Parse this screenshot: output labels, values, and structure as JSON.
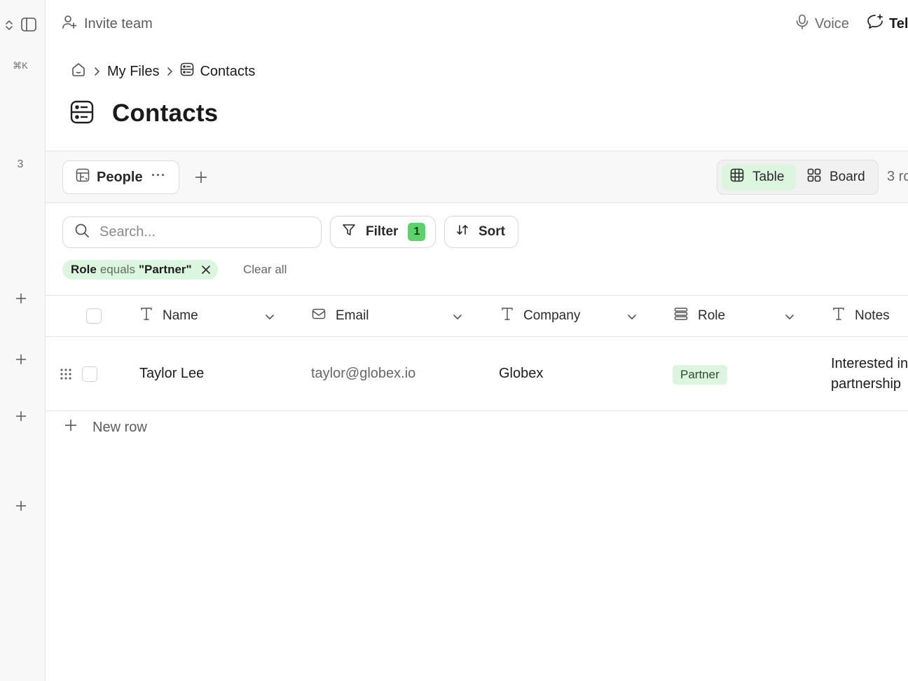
{
  "rail": {
    "shortcut": "⌘K",
    "count": "3"
  },
  "topbar": {
    "invite_label": "Invite team",
    "voice_label": "Voice",
    "tell_label": "Tel"
  },
  "breadcrumb": {
    "items": [
      "My Files",
      "Contacts"
    ]
  },
  "page": {
    "title": "Contacts"
  },
  "views": {
    "active_view": "People",
    "more": "···",
    "modes": [
      {
        "label": "Table",
        "active": true
      },
      {
        "label": "Board",
        "active": false
      }
    ],
    "rows_count": "3 ro"
  },
  "toolbar": {
    "search_placeholder": "Search...",
    "filter_label": "Filter",
    "filter_count": "1",
    "sort_label": "Sort"
  },
  "active_filter": {
    "field": "Role",
    "operator": "equals",
    "value": "\"Partner\"",
    "clear_label": "Clear all"
  },
  "table": {
    "columns": [
      {
        "label": "Name",
        "icon": "text-type-icon"
      },
      {
        "label": "Email",
        "icon": "mail-icon"
      },
      {
        "label": "Company",
        "icon": "text-type-icon"
      },
      {
        "label": "Role",
        "icon": "select-list-icon"
      },
      {
        "label": "Notes",
        "icon": "text-type-icon"
      }
    ],
    "rows": [
      {
        "name": "Taylor Lee",
        "email": "taylor@globex.io",
        "company": "Globex",
        "role": "Partner",
        "notes": "Interested in partnership"
      }
    ],
    "new_row_label": "New row"
  },
  "colors": {
    "accent_green": "#5cd26b",
    "accent_green_light": "#dcf5df",
    "rail_bg": "#f8f8f8",
    "border": "#e3e3e3"
  }
}
